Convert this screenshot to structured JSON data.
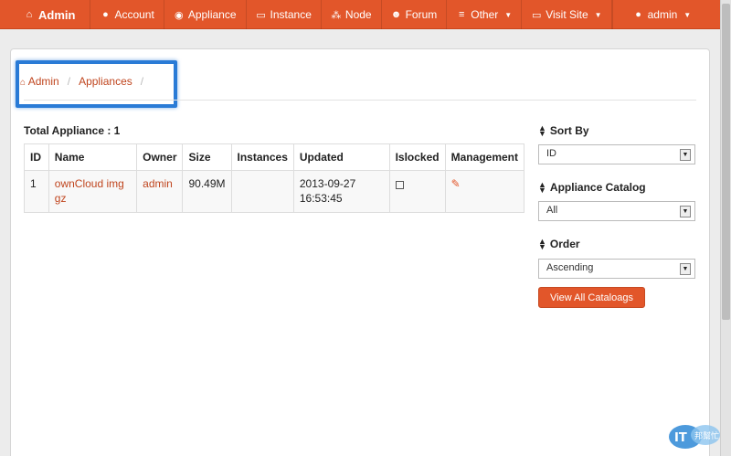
{
  "nav": {
    "brand": "Admin",
    "items": [
      {
        "label": "Account",
        "icon": "user-icon"
      },
      {
        "label": "Appliance",
        "icon": "globe-icon"
      },
      {
        "label": "Instance",
        "icon": "hdd-icon"
      },
      {
        "label": "Node",
        "icon": "sitemap-icon"
      },
      {
        "label": "Forum",
        "icon": "group-icon"
      },
      {
        "label": "Other",
        "icon": "list-icon"
      },
      {
        "label": "Visit Site",
        "icon": "monitor-icon"
      }
    ],
    "user": "admin",
    "color": "#e2562a"
  },
  "breadcrumb": {
    "home": "Admin",
    "current": "Appliances",
    "sep": "/"
  },
  "total_label": "Total Appliance : 1",
  "table": {
    "headers": [
      "ID",
      "Name",
      "Owner",
      "Size",
      "Instances",
      "Updated",
      "Islocked",
      "Management"
    ],
    "rows": [
      {
        "id": "1",
        "name": "ownCloud img gz",
        "owner": "admin",
        "size": "90.49M",
        "instances": "",
        "updated": "2013-09-27 16:53:45",
        "islocked": false
      }
    ]
  },
  "sidebar": {
    "sort_by_label": "Sort By",
    "sort_by_value": "ID",
    "catalog_label": "Appliance Catalog",
    "catalog_value": "All",
    "order_label": "Order",
    "order_value": "Ascending",
    "view_all_button": "View All Cataloags"
  },
  "watermark": {
    "text": "iT邦幫忙"
  }
}
